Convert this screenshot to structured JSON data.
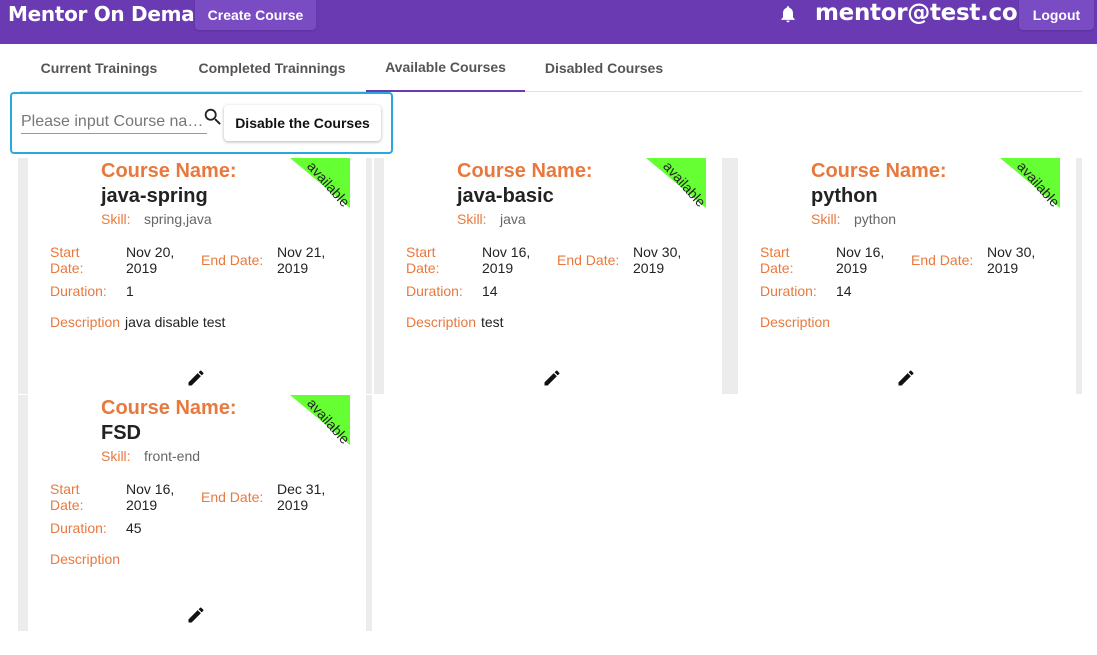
{
  "header": {
    "brand": "Mentor On Demand",
    "create_label": "Create Course",
    "user": "mentor@test.com",
    "logout_label": "Logout",
    "bell_icon": "bell-icon"
  },
  "tabs": [
    {
      "label": "Current Trainings",
      "active": false
    },
    {
      "label": "Completed Trainnings",
      "active": false
    },
    {
      "label": "Available Courses",
      "active": true
    },
    {
      "label": "Disabled Courses",
      "active": false
    }
  ],
  "search": {
    "placeholder": "Please input Course na…",
    "icon": "search-icon",
    "disable_label": "Disable the Courses"
  },
  "card_labels": {
    "course_name": "Course Name:",
    "skill": "Skill:",
    "start_date_line1": "Start",
    "start_date_line2": "Date:",
    "end_date": "End Date:",
    "duration": "Duration:",
    "description": "Description",
    "status": "available"
  },
  "courses": [
    {
      "name": "java-spring",
      "skill": "spring,java",
      "start_1": "Nov 20,",
      "start_2": "2019",
      "end_1": "Nov 21,",
      "end_2": "2019",
      "duration": "1",
      "description": "java disable test"
    },
    {
      "name": "java-basic",
      "skill": "java",
      "start_1": "Nov 16,",
      "start_2": "2019",
      "end_1": "Nov 30,",
      "end_2": "2019",
      "duration": "14",
      "description": "test"
    },
    {
      "name": "python",
      "skill": "python",
      "start_1": "Nov 16,",
      "start_2": "2019",
      "end_1": "Nov 30,",
      "end_2": "2019",
      "duration": "14",
      "description": ""
    },
    {
      "name": "FSD",
      "skill": "front-end",
      "start_1": "Nov 16,",
      "start_2": "2019",
      "end_1": "Dec 31,",
      "end_2": "2019",
      "duration": "45",
      "description": ""
    }
  ],
  "colors": {
    "header_bg": "#6a3ab2",
    "accent_orange": "#e8793e",
    "ribbon_green": "#66ff33",
    "search_border": "#29a8e0"
  }
}
